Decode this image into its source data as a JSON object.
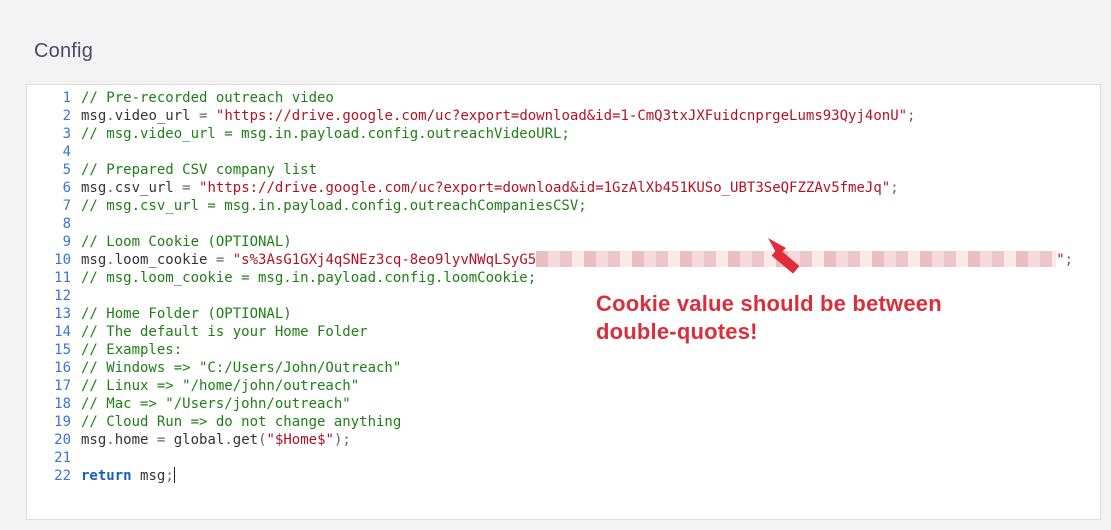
{
  "panel": {
    "title": "Config"
  },
  "annotation": {
    "line1": "Cookie value should be between",
    "line2": "double-quotes!"
  },
  "tokens": {
    "msg": "msg",
    "dot": ".",
    "eq": " = ",
    "semi": ";",
    "video_url": "video_url",
    "csv_url": "csv_url",
    "loom_cookie": "loom_cookie",
    "home": "home",
    "global": "global",
    "get": "get",
    "lparen": "(",
    "rparen": ")",
    "return": "return",
    "space": " "
  },
  "strings": {
    "video_url_val": "\"https://drive.google.com/uc?export=download&id=1-CmQ3txJXFuidcnprgeLums93Qyj4onU\"",
    "csv_url_val": "\"https://drive.google.com/uc?export=download&id=1GzAlXb451KUSo_UBT3SeQFZZAv5fmeJq\"",
    "loom_prefix": "\"s%3AsG1GXj4qSNEz3cq-8eo9lyvNWqLSyG5",
    "loom_suffix": "\"",
    "home_arg": "\"$Home$\""
  },
  "comments": {
    "c1": "// Pre-recorded outreach video",
    "c3": "// msg.video_url = msg.in.payload.config.outreachVideoURL;",
    "c5": "// Prepared CSV company list",
    "c7": "// msg.csv_url = msg.in.payload.config.outreachCompaniesCSV;",
    "c9": "// Loom Cookie (OPTIONAL)",
    "c11": "// msg.loom_cookie = msg.in.payload.config.loomCookie;",
    "c13": "// Home Folder (OPTIONAL)",
    "c14": "// The default is your Home Folder",
    "c15": "// Examples:",
    "c16": "// Windows => \"C:/Users/John/Outreach\"",
    "c17": "// Linux => \"/home/john/outreach\"",
    "c18": "// Mac => \"/Users/john/outreach\"",
    "c19": "// Cloud Run => do not change anything"
  },
  "gutter": {
    "l1": "1",
    "l2": "2",
    "l3": "3",
    "l4": "4",
    "l5": "5",
    "l6": "6",
    "l7": "7",
    "l8": "8",
    "l9": "9",
    "l10": "10",
    "l11": "11",
    "l12": "12",
    "l13": "13",
    "l14": "14",
    "l15": "15",
    "l16": "16",
    "l17": "17",
    "l18": "18",
    "l19": "19",
    "l20": "20",
    "l21": "21",
    "l22": "22"
  }
}
